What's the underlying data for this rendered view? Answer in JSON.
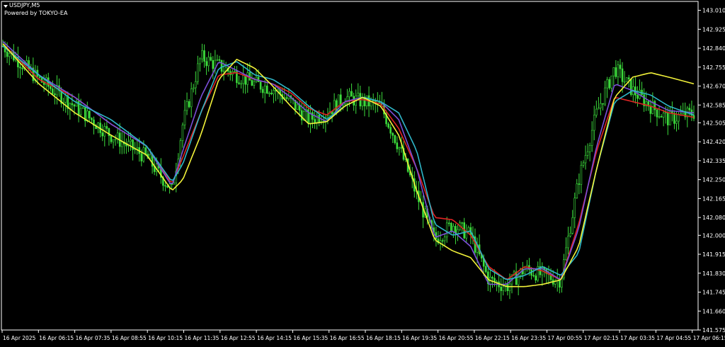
{
  "header": {
    "symbol_label": "USDJPY,M5",
    "powered_by": "Powered by TOKYO-EA"
  },
  "colors": {
    "background": "#000000",
    "frame": "#ffffff",
    "candles": "#3cdc3c",
    "ma_fast": "#e02424",
    "ma_mid": "#7b4fd8",
    "ma_slow": "#2fb7c8",
    "ma_trend": "#f2f23a"
  },
  "chart_data": {
    "type": "line",
    "title": "",
    "symbol": "USDJPY",
    "timeframe": "M5",
    "xlabel": "",
    "ylabel": "",
    "ylim": [
      141.575,
      143.05
    ],
    "grid": false,
    "y_ticks": [
      "143.010",
      "142.925",
      "142.840",
      "142.755",
      "142.670",
      "142.585",
      "142.505",
      "142.420",
      "142.335",
      "142.250",
      "142.165",
      "142.080",
      "142.000",
      "141.915",
      "141.830",
      "141.745",
      "141.660",
      "141.575"
    ],
    "x_ticks": [
      "16 Apr 2025",
      "16 Apr 06:15",
      "16 Apr 07:35",
      "16 Apr 08:55",
      "16 Apr 10:15",
      "16 Apr 11:35",
      "16 Apr 12:55",
      "16 Apr 14:15",
      "16 Apr 15:35",
      "16 Apr 16:55",
      "16 Apr 18:15",
      "16 Apr 19:35",
      "16 Apr 20:55",
      "16 Apr 22:15",
      "16 Apr 23:35",
      "17 Apr 00:55",
      "17 Apr 02:15",
      "17 Apr 03:35",
      "17 Apr 04:55",
      "17 Apr 06:15"
    ],
    "price_path": {
      "x": [
        0,
        1,
        2,
        3,
        4,
        4.7,
        5,
        5.5,
        6,
        6.5,
        7,
        7.5,
        8,
        8.5,
        9,
        9.5,
        10,
        10.5,
        11,
        11.5,
        12,
        12.5,
        13,
        13.5,
        14,
        14.5,
        15,
        15.5,
        16,
        16.5,
        17,
        17.5,
        18,
        18.5,
        19.2
      ],
      "y": [
        142.85,
        142.7,
        142.58,
        142.45,
        142.35,
        142.2,
        142.5,
        142.8,
        142.76,
        142.72,
        142.68,
        142.66,
        142.6,
        142.52,
        142.55,
        142.62,
        142.6,
        142.58,
        142.4,
        142.18,
        141.98,
        142.05,
        142.0,
        141.8,
        141.77,
        141.85,
        141.82,
        141.8,
        142.25,
        142.55,
        142.75,
        142.65,
        142.58,
        142.52,
        142.55
      ]
    },
    "series": [
      {
        "name": "",
        "color": "#e02424",
        "x": [
          0,
          1,
          2,
          3,
          4,
          4.7,
          5,
          5.5,
          6,
          6.5,
          7,
          7.5,
          8,
          8.5,
          9,
          9.5,
          10,
          10.5,
          11,
          11.5,
          12,
          12.5,
          13,
          13.5,
          14,
          14.5,
          15,
          15.5,
          16,
          16.5,
          17,
          17.5,
          18,
          18.5,
          19.2
        ],
        "y": [
          142.86,
          142.7,
          142.62,
          142.5,
          142.4,
          142.23,
          142.35,
          142.55,
          142.72,
          142.73,
          142.7,
          142.68,
          142.64,
          142.57,
          142.54,
          142.6,
          142.61,
          142.59,
          142.48,
          142.3,
          142.08,
          142.07,
          142.0,
          141.86,
          141.8,
          141.86,
          141.84,
          141.8,
          142.05,
          142.38,
          142.62,
          142.6,
          142.58,
          142.55,
          142.53
        ]
      },
      {
        "name": "",
        "color": "#7b4fd8",
        "x": [
          0,
          1,
          2,
          3,
          4,
          4.7,
          5,
          5.5,
          6,
          6.5,
          7,
          7.5,
          8,
          8.5,
          9,
          9.5,
          10,
          10.5,
          11,
          11.5,
          12,
          12.5,
          13,
          13.5,
          14,
          14.5,
          15,
          15.5,
          16,
          16.5,
          17,
          17.5,
          18,
          18.5,
          19.2
        ],
        "y": [
          142.87,
          142.72,
          142.62,
          142.5,
          142.4,
          142.22,
          142.38,
          142.62,
          142.78,
          142.74,
          142.7,
          142.68,
          142.62,
          142.55,
          142.51,
          142.6,
          142.62,
          142.6,
          142.52,
          142.3,
          141.99,
          142.02,
          141.95,
          141.78,
          141.78,
          141.85,
          141.85,
          141.8,
          142.03,
          142.4,
          142.68,
          142.65,
          142.6,
          142.56,
          142.55
        ]
      },
      {
        "name": "",
        "color": "#2fb7c8",
        "x": [
          0,
          1,
          2,
          3,
          4,
          4.7,
          5,
          5.5,
          6,
          6.5,
          7,
          7.5,
          8,
          8.5,
          9,
          9.5,
          10,
          10.5,
          11,
          11.5,
          12,
          12.5,
          13,
          13.5,
          14,
          14.5,
          15,
          15.5,
          16,
          16.5,
          17,
          17.5,
          18,
          18.5,
          19.2
        ],
        "y": [
          142.85,
          142.72,
          142.6,
          142.52,
          142.4,
          142.24,
          142.32,
          142.55,
          142.75,
          142.78,
          142.72,
          142.7,
          142.65,
          142.58,
          142.52,
          142.58,
          142.62,
          142.6,
          142.55,
          142.38,
          142.05,
          142.0,
          142.02,
          141.85,
          141.8,
          141.82,
          141.86,
          141.82,
          141.92,
          142.3,
          142.6,
          142.65,
          142.63,
          142.58,
          142.54
        ]
      },
      {
        "name": "",
        "color": "#f2f23a",
        "x": [
          0,
          1,
          2,
          3,
          4,
          4.7,
          5,
          5.5,
          6,
          6.5,
          7,
          7.5,
          8,
          8.5,
          9,
          9.5,
          10,
          10.5,
          11,
          11.5,
          12,
          12.5,
          13,
          13.5,
          14,
          14.5,
          15,
          15.5,
          16,
          16.5,
          17,
          17.5,
          18,
          18.5,
          19.2
        ],
        "y": [
          142.86,
          142.68,
          142.55,
          142.45,
          142.36,
          142.2,
          142.25,
          142.45,
          142.7,
          142.79,
          142.75,
          142.67,
          142.58,
          142.5,
          142.51,
          142.58,
          142.62,
          142.58,
          142.45,
          142.2,
          141.98,
          141.93,
          141.9,
          141.8,
          141.77,
          141.77,
          141.78,
          141.8,
          141.95,
          142.3,
          142.62,
          142.71,
          142.73,
          142.71,
          142.68
        ]
      }
    ]
  }
}
